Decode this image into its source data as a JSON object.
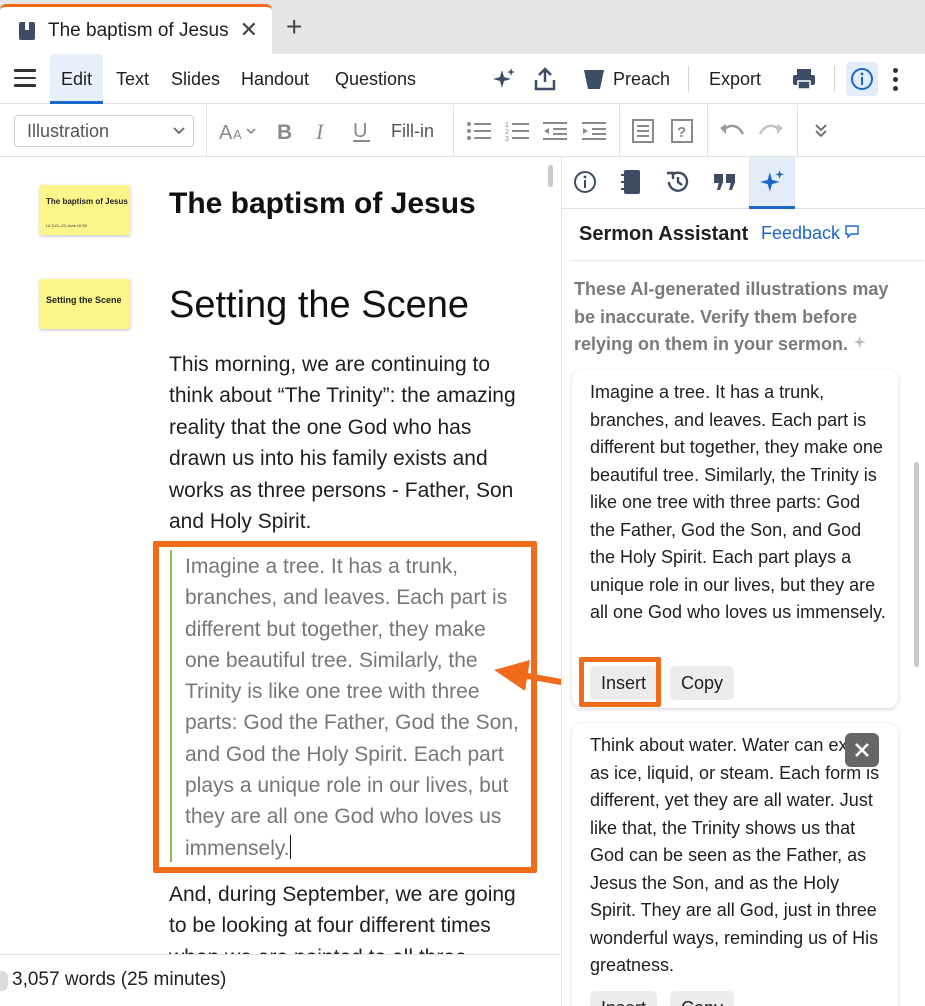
{
  "tab": {
    "title": "The baptism of Jesus",
    "close": "✕",
    "add": "+"
  },
  "toolbar": {
    "tabs": [
      "Edit",
      "Text",
      "Slides",
      "Handout",
      "Questions"
    ],
    "preach_label": "Preach",
    "export_label": "Export"
  },
  "format": {
    "style_value": "Illustration",
    "fill_in_label": "Fill-in"
  },
  "editor": {
    "slide1": {
      "title": "The baptism of Jesus",
      "ref": "Lk 3:21–22; Acts 10:38"
    },
    "slide2": {
      "title": "Setting the Scene"
    },
    "doc_title": "The baptism of Jesus",
    "section_heading": "Setting the Scene",
    "para1": "This morning, we are continuing to think about “The Trinity”: the amazing reality that the one God who has drawn us into his family exists and works as three persons - Father, Son and Holy Spirit.",
    "quote": "Imagine a tree. It has a trunk, branches, and leaves. Each part is different but together, they make one beautiful tree. Similarly, the Trinity is like one tree with three parts: God the Father, God the Son, and God the Holy Spirit. Each part plays a unique role in our lives, but they are all one God who loves us immensely.",
    "para2": "And, during September, we are going to be looking at four different times when we are pointed to all three"
  },
  "panel": {
    "title": "Sermon Assistant",
    "feedback": "Feedback",
    "disclaimer": "These AI-generated illustrations may be inaccurate. Verify them before relying on them in your sermon.",
    "cards": [
      {
        "text": "Imagine a tree. It has a trunk, branches, and leaves. Each part is different but together, they make one beautiful tree. Similarly, the Trinity is like one tree with three parts: God the Father, God the Son, and God the Holy Spirit. Each part plays a unique role in our lives, but they are all one God who loves us immensely.",
        "insert": "Insert",
        "copy": "Copy"
      },
      {
        "text": "Think about water. Water can exist as ice, liquid, or steam. Each form is different, yet they are all water. Just like that, the Trinity shows us that God can be seen as the Father, as Jesus the Son, and as the Holy Spirit. They are all God, just in three wonderful ways, reminding us of His greatness.",
        "insert": "Insert",
        "copy": "Copy"
      }
    ]
  },
  "status": {
    "word_count": "3,057 words (25 minutes)"
  },
  "colors": {
    "accent": "#f06b1a",
    "link": "#1b66c9",
    "quote_bar": "#8bbd4b",
    "slide_bg": "#fbf58a"
  }
}
